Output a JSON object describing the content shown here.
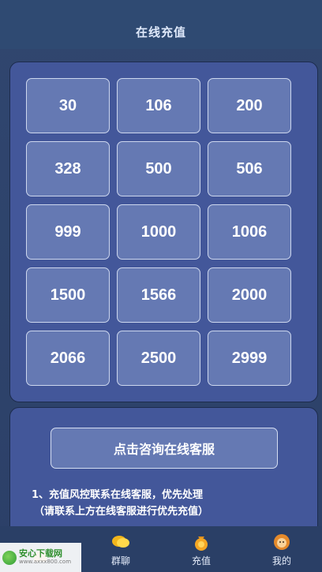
{
  "header": {
    "title": "在线充值"
  },
  "amounts": [
    "30",
    "106",
    "200",
    "328",
    "500",
    "506",
    "999",
    "1000",
    "1006",
    "1500",
    "1566",
    "2000",
    "2066",
    "2500",
    "2999"
  ],
  "service": {
    "consult_label": "点击咨询在线客服",
    "note_line1": "1、充值风控联系在线客服，优先处理",
    "note_line2": "（请联系上方在线客服进行优先充值）"
  },
  "tabs": [
    {
      "label": "",
      "icon": "home-icon"
    },
    {
      "label": "群聊",
      "icon": "chat-bubbles-icon"
    },
    {
      "label": "充值",
      "icon": "coin-bag-icon"
    },
    {
      "label": "我的",
      "icon": "profile-avatar-icon"
    }
  ],
  "watermark": {
    "name": "安心下载网",
    "url": "www.axxx800.com"
  },
  "colors": {
    "background": "#2e4470",
    "panel": "#43579a",
    "button": "#6579b3",
    "button_border": "#cdd7ee"
  }
}
